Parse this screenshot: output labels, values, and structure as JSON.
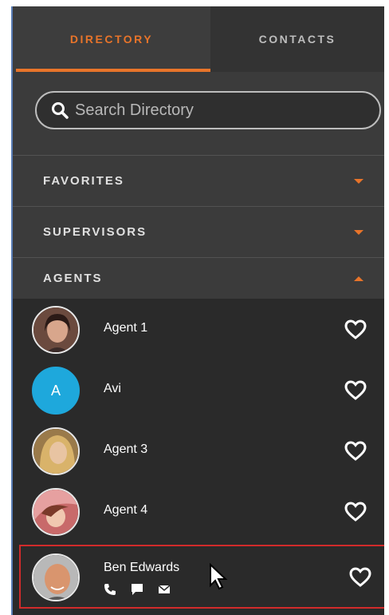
{
  "tabs": [
    {
      "label": "DIRECTORY",
      "active": true
    },
    {
      "label": "CONTACTS",
      "active": false
    }
  ],
  "search": {
    "placeholder": "Search Directory",
    "value": ""
  },
  "sections": [
    {
      "label": "FAVORITES",
      "state": "collapsed"
    },
    {
      "label": "SUPERVISORS",
      "state": "collapsed"
    },
    {
      "label": "AGENTS",
      "state": "expanded"
    }
  ],
  "agents": [
    {
      "name": "Agent 1",
      "avatar": "photo"
    },
    {
      "name": "Avi",
      "avatar": "initial",
      "initial": "A"
    },
    {
      "name": "Agent 3",
      "avatar": "photo"
    },
    {
      "name": "Agent 4",
      "avatar": "photo"
    },
    {
      "name": "Ben Edwards",
      "avatar": "photo",
      "selected": true,
      "actions": [
        "phone-icon",
        "chat-icon",
        "email-icon"
      ]
    }
  ],
  "colors": {
    "accent": "#e8742a",
    "selection": "#d12b2b",
    "avatar_initial_bg": "#1ea8dc"
  }
}
